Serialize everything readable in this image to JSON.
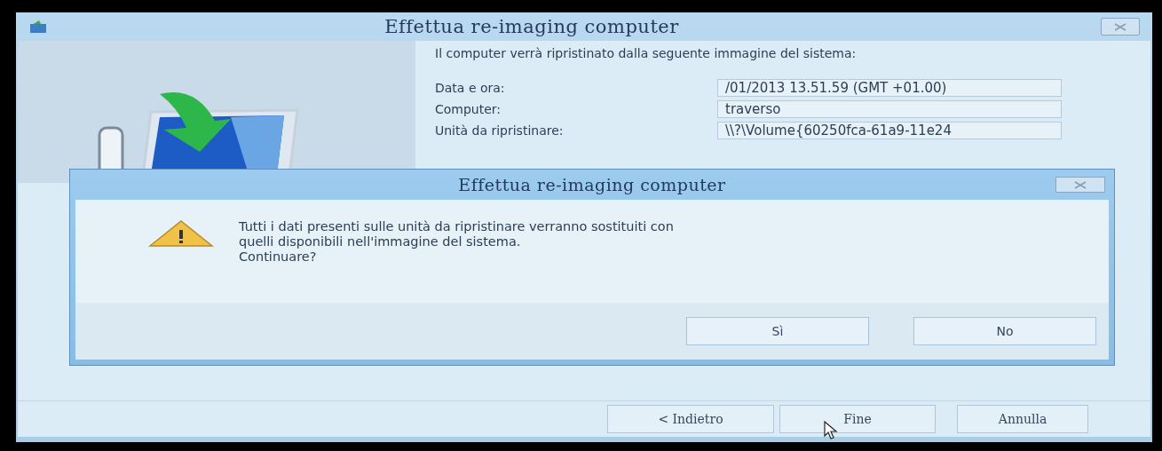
{
  "window": {
    "title": "Effettua re-imaging computer"
  },
  "intro": "Il computer verrà ripristinato dalla seguente immagine del sistema:",
  "fields": [
    {
      "label": "Data e ora:",
      "value": "/01/2013 13.51.59 (GMT +01.00)"
    },
    {
      "label": "Computer:",
      "value": "traverso"
    },
    {
      "label": "Unità da ripristinare:",
      "value": "\\\\?\\Volume{60250fca-61a9-11e24"
    }
  ],
  "buttons": [
    {
      "label": "< Indietro"
    },
    {
      "label": "Fine"
    },
    {
      "label": "Annulla"
    }
  ],
  "dialog": {
    "title": "Effettua re-imaging computer",
    "message_lines": [
      "Tutti i dati presenti sulle unità da ripristinare verranno sostituiti con",
      "quelli disponibili nell'immagine del sistema.",
      "Continuare?"
    ],
    "buttons": [
      {
        "label": "Sì"
      },
      {
        "label": "No"
      }
    ]
  }
}
